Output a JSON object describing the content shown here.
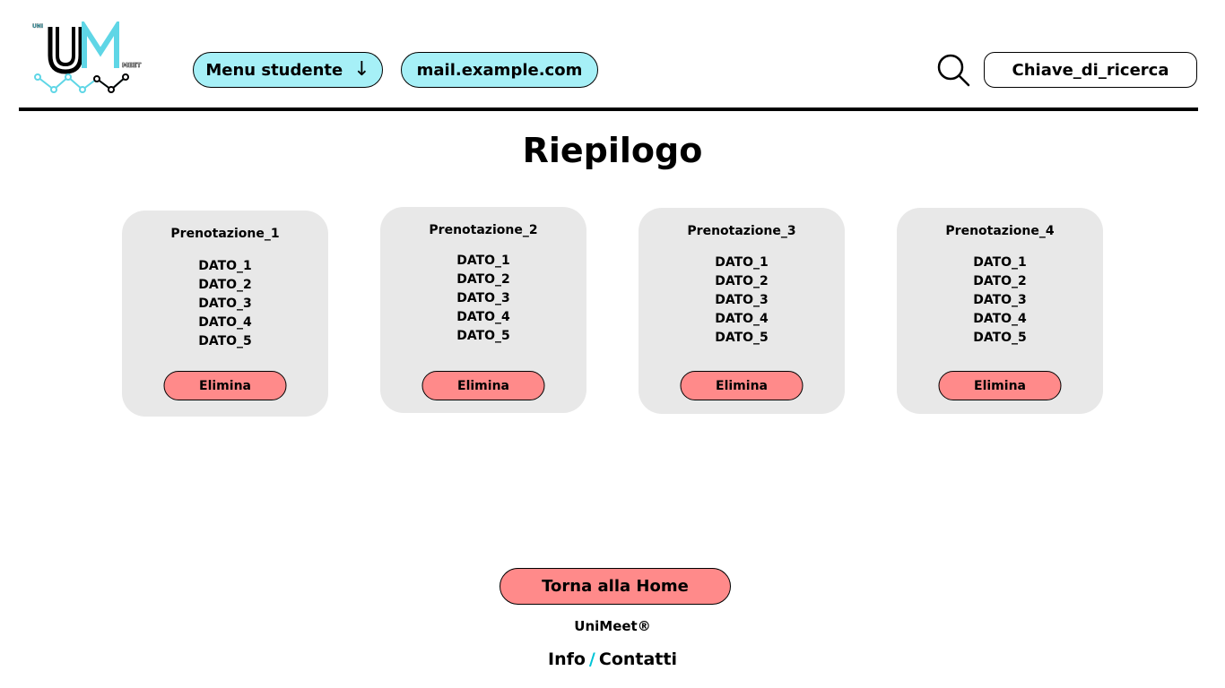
{
  "header": {
    "logo_text": "UM",
    "logo_top_text": "UNI",
    "logo_side_text": "MEET",
    "menu_label": "Menu studente",
    "menu_arrow": "↓",
    "email": "mail.example.com",
    "search_placeholder": "Chiave_di_ricerca"
  },
  "main": {
    "title": "Riepilogo",
    "cards": [
      {
        "title": "Prenotazione_1",
        "fields": [
          "DATO_1",
          "DATO_2",
          "DATO_3",
          "DATO_4",
          "DATO_5"
        ],
        "button": "Elimina"
      },
      {
        "title": "Prenotazione_2",
        "fields": [
          "DATO_1",
          "DATO_2",
          "DATO_3",
          "DATO_4",
          "DATO_5"
        ],
        "button": "Elimina"
      },
      {
        "title": "Prenotazione_3",
        "fields": [
          "DATO_1",
          "DATO_2",
          "DATO_3",
          "DATO_4",
          "DATO_5"
        ],
        "button": "Elimina"
      },
      {
        "title": "Prenotazione_4",
        "fields": [
          "DATO_1",
          "DATO_2",
          "DATO_3",
          "DATO_4",
          "DATO_5"
        ],
        "button": "Elimina"
      }
    ]
  },
  "footer": {
    "home_button": "Torna alla Home",
    "brand": "UniMeet®",
    "info": "Info",
    "separator": "/",
    "contacts": "Contatti"
  },
  "colors": {
    "accent_cyan": "#a6f0f7",
    "danger_pink": "#ff8a8a",
    "card_bg": "#e8e8e8",
    "separator_teal": "#00c4d6"
  },
  "icons": {
    "logo": "unimeet-logo",
    "search": "search-icon"
  }
}
